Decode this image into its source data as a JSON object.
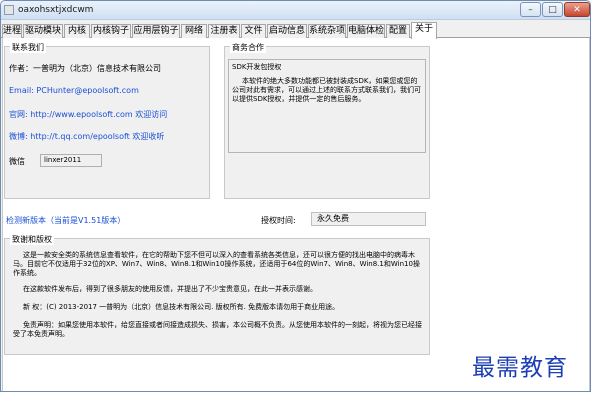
{
  "window": {
    "title": "oaxohsxtjxdcwm",
    "controls": {
      "minimize": "–",
      "maximize": "□",
      "close": "✕"
    }
  },
  "tabs": [
    {
      "label": "进程"
    },
    {
      "label": "驱动模块"
    },
    {
      "label": "内核"
    },
    {
      "label": "内核钩子"
    },
    {
      "label": "应用层钩子"
    },
    {
      "label": "网络"
    },
    {
      "label": "注册表"
    },
    {
      "label": "文件"
    },
    {
      "label": "启动信息"
    },
    {
      "label": "系统杂项"
    },
    {
      "label": "电脑体检"
    },
    {
      "label": "配置"
    },
    {
      "label": "关于"
    }
  ],
  "active_tab": "关于",
  "contact": {
    "title": "联系我们",
    "author": "作者：一普明为（北京）信息技术有限公司",
    "email": "Email: PCHunter@epoolsoft.com",
    "website": "官网: http://www.epoolsoft.com 欢迎访问",
    "weibo": "微博: http://t.qq.com/epoolsoft 欢迎收听",
    "wechat_label": "微信",
    "wechat_value": "linxer2011"
  },
  "business": {
    "title": "商务合作",
    "box_head": "SDK开发包授权",
    "box_body": "本软件的绝大多数功能都已被封装成SDK，如果您或您的公司对此有需求，可以通过上述的联系方式联系我们，我们可以提供SDK授权，并提供一定的售后服务。"
  },
  "update": {
    "check_link": "检测新版本（当前是V1.51版本）",
    "auth_label": "授权时间:",
    "auth_value": "永久免费"
  },
  "credits": {
    "title": "致谢和版权",
    "p1": "这是一款安全类的系统信息查看软件，在它的帮助下您不但可以深入的查看系统各类信息，还可以很方便的找出电脑中的病毒木马。目前它不仅适用于32位的XP、Win7、Win8、Win8.1和Win10操作系统，还适用于64位的Win7、Win8、Win8.1和Win10操作系统。",
    "p2": "在这款软件发布后，得到了很多朋友的使用反馈，并提出了不少宝贵意见，在此一并表示感谢。",
    "p3": "新    权：(C) 2013-2017 一普明为（北京）信息技术有限公司. 版权所有. 免费版本请勿用于商业用途。",
    "p4": "免责声明：如果您使用本软件，给您直接或者间接造成损失、损害，本公司概不负责。从您使用本软件的一刻起，将视为您已经接受了本免责声明。"
  },
  "watermark": "最需教育"
}
